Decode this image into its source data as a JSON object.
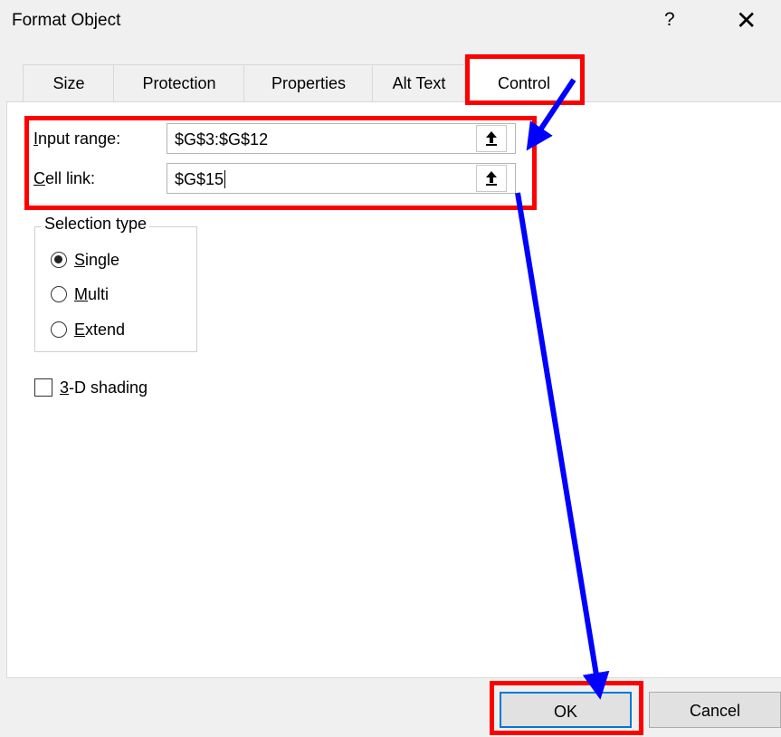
{
  "window": {
    "title": "Format Object",
    "help_glyph": "?",
    "close_glyph": "✕"
  },
  "tabs": [
    {
      "label": "Size",
      "active": false
    },
    {
      "label": "Protection",
      "active": false
    },
    {
      "label": "Properties",
      "active": false
    },
    {
      "label": "Alt Text",
      "active": false
    },
    {
      "label": "Control",
      "active": true
    }
  ],
  "control": {
    "input_range": {
      "label_accel": "I",
      "label_rest": "nput range:",
      "value": "$G$3:$G$12"
    },
    "cell_link": {
      "label_accel": "C",
      "label_rest": "ell link:",
      "value": "$G$15"
    },
    "picker_icon": "collapse-range-arrow-icon",
    "selection_type": {
      "title": "Selection type",
      "options": [
        {
          "accel": "S",
          "rest": "ingle",
          "selected": true
        },
        {
          "accel": "M",
          "rest": "ulti",
          "selected": false
        },
        {
          "accel": "E",
          "rest": "xtend",
          "selected": false
        }
      ]
    },
    "shading": {
      "accel": "3",
      "rest": "-D shading",
      "checked": false
    }
  },
  "buttons": {
    "ok": "OK",
    "cancel": "Cancel"
  },
  "annotations": {
    "highlight_color": "#ff0000",
    "arrow_color": "#0000ff"
  }
}
